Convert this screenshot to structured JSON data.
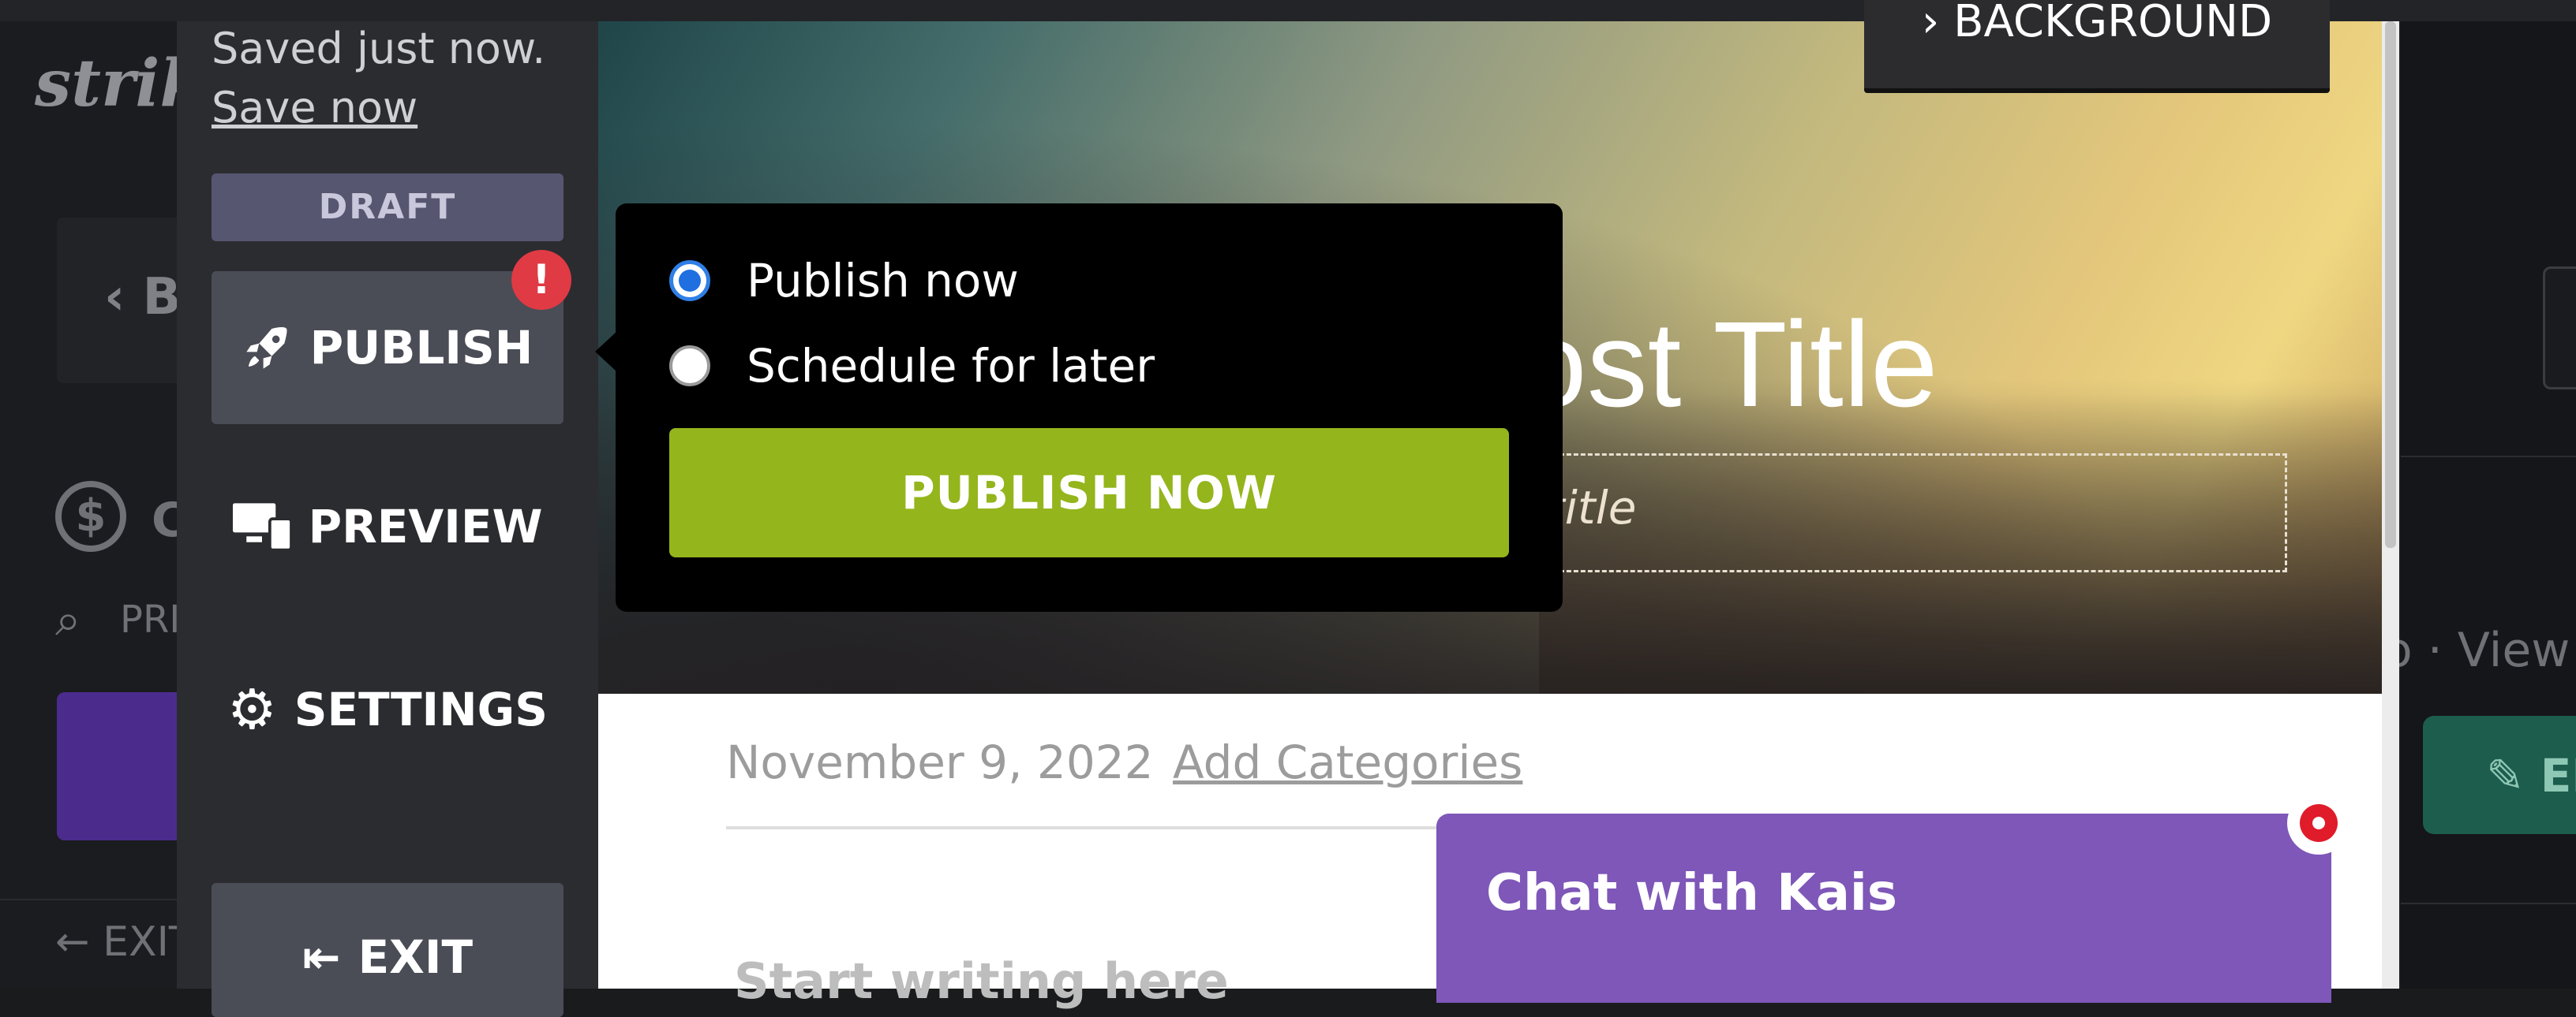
{
  "background": {
    "logo": "strik",
    "back_label": "B",
    "currency_label": "C",
    "search_label": "PRI",
    "exit_label": "EXIT",
    "right_view_text": "o · View",
    "right_button_label": "EI"
  },
  "editor": {
    "background_button": "BACKGROUND",
    "post_title": "ost Title",
    "subtitle_placeholder": "title",
    "date": "November 9, 2022",
    "add_categories": "Add Categories",
    "body_placeholder": "Start writing here"
  },
  "panel": {
    "saved_status": "Saved just now.",
    "save_now": "Save now",
    "draft_label": "DRAFT",
    "publish_label": "PUBLISH",
    "publish_badge": "!",
    "preview_label": "PREVIEW",
    "settings_label": "SETTINGS",
    "exit_label": "EXIT"
  },
  "publish_popover": {
    "options": [
      "Publish now",
      "Schedule for later"
    ],
    "selected": "Publish now",
    "action_label": "PUBLISH NOW"
  },
  "chat": {
    "title": "Chat with Kais"
  },
  "colors": {
    "accent_green": "#94b51c",
    "chat_purple": "#7e57b8",
    "badge_red": "#e03a45",
    "draft_purple": "#575670"
  }
}
